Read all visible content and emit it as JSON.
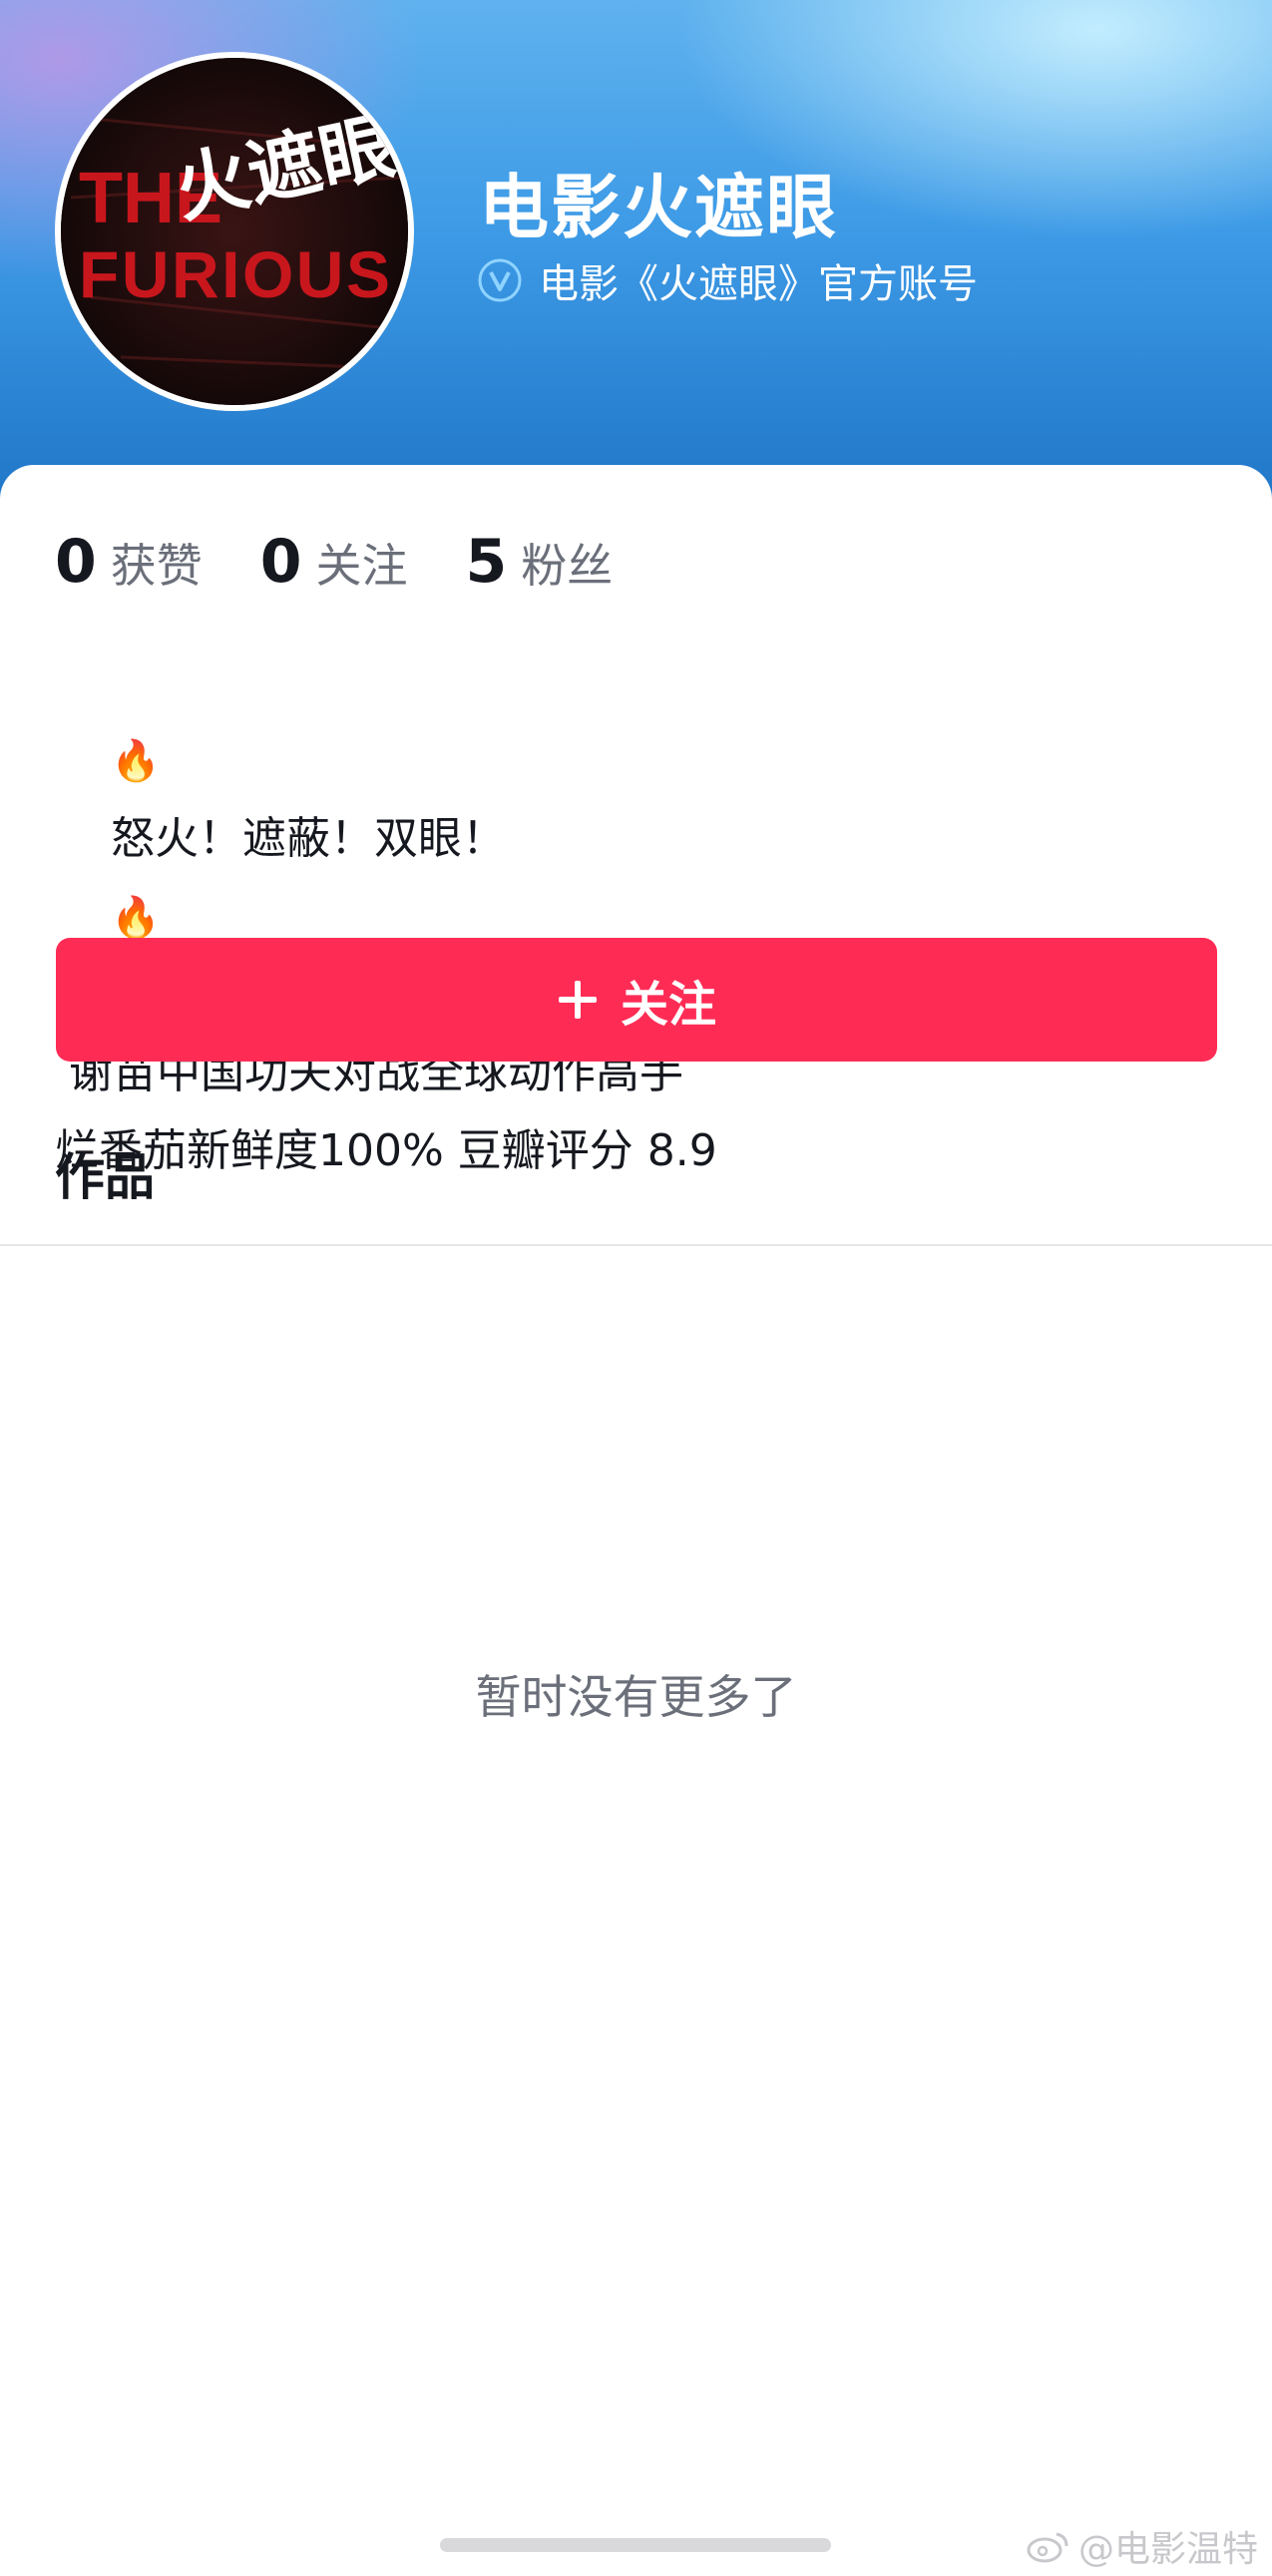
{
  "profile": {
    "name": "电影火遮眼",
    "verified_label": "电影《火遮眼》官方账号",
    "avatar_text": {
      "en_line1": "THE",
      "en_line2": "FURIOUS",
      "cn": "火遮眼"
    }
  },
  "stats": [
    {
      "value": "0",
      "label": "获赞"
    },
    {
      "value": "0",
      "label": "关注"
    },
    {
      "value": "5",
      "label": "粉丝"
    }
  ],
  "bio": {
    "line1": "怒火！遮蔽！双眼！",
    "line2": " 谢苗中国功夫对战全球动作高手",
    "line3": "烂番茄新鲜度100% 豆瓣评分 8.9",
    "emoji": "🔥"
  },
  "follow_button": {
    "label": "关注"
  },
  "tabs": {
    "works": "作品"
  },
  "empty_state": "暂时没有更多了",
  "watermark": "@电影温特",
  "colors": {
    "accent": "#fe2c55",
    "header_top": "#5fb2ee",
    "header_bottom": "#1f74c6",
    "text_primary": "#16181f",
    "text_secondary": "#6b6f7a"
  },
  "icons": [
    "verified-v-icon",
    "plus-icon",
    "fire-emoji",
    "weibo-icon"
  ]
}
